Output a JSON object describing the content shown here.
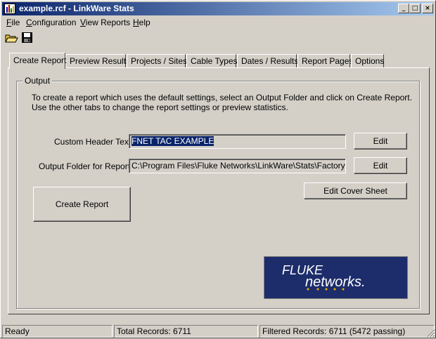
{
  "window": {
    "title": "example.rcf - LinkWare Stats",
    "controls": {
      "minimize": "_",
      "maximize": "□",
      "close": "×"
    }
  },
  "menu": [
    {
      "label": "File",
      "accel": "F",
      "rest": "ile"
    },
    {
      "label": "Configuration",
      "accel": "C",
      "rest": "onfiguration"
    },
    {
      "label": "View Reports",
      "accel": "V",
      "rest": "iew Reports"
    },
    {
      "label": "Help",
      "accel": "H",
      "rest": "elp"
    }
  ],
  "toolbar": {
    "open_icon": "open-folder-icon",
    "save_icon": "floppy-disk-icon"
  },
  "tabs": [
    {
      "label": "Create Report",
      "active": true
    },
    {
      "label": "Preview Results"
    },
    {
      "label": "Projects / Sites"
    },
    {
      "label": "Cable Types"
    },
    {
      "label": "Dates / Results"
    },
    {
      "label": "Report Pages"
    },
    {
      "label": "Options"
    }
  ],
  "output": {
    "group_label": "Output",
    "description": "To  create a  report which uses the default settings, select an Output Folder and click on Create Report.  Use the other tabs to change the report settings or preview statistics.",
    "header_label": "Custom Header Text:",
    "header_value": "FNET TAC EXAMPLE",
    "folder_label": "Output Folder for Reports:",
    "folder_value": "C:\\Program Files\\Fluke Networks\\LinkWare\\Stats\\FactoryDefa",
    "edit_header_button": "Edit",
    "edit_folder_button": "Edit",
    "edit_cover_button": "Edit Cover Sheet",
    "create_report_button": "Create Report"
  },
  "logo": {
    "brand": "FLUKE",
    "sub": "networks."
  },
  "status": {
    "state": "Ready",
    "total": "Total Records: 6711",
    "filtered": "Filtered Records: 6711 (5472 passing)"
  },
  "colors": {
    "titlebar_start": "#0a246a",
    "titlebar_end": "#a6caf0",
    "logo_bg": "#1d2d6b",
    "logo_accent": "#f0b400"
  }
}
